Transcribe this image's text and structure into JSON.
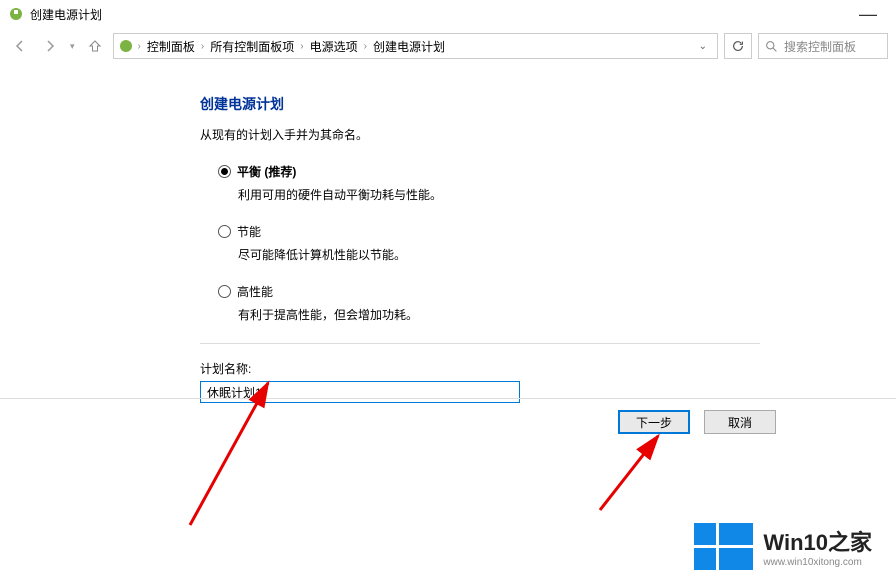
{
  "titlebar": {
    "title": "创建电源计划"
  },
  "breadcrumb": {
    "items": [
      "控制面板",
      "所有控制面板项",
      "电源选项",
      "创建电源计划"
    ]
  },
  "search": {
    "placeholder": "搜索控制面板"
  },
  "page": {
    "title": "创建电源计划",
    "subtitle": "从现有的计划入手并为其命名。"
  },
  "options": {
    "balanced": {
      "label": "平衡 (推荐)",
      "desc": "利用可用的硬件自动平衡功耗与性能。"
    },
    "saver": {
      "label": "节能",
      "desc": "尽可能降低计算机性能以节能。"
    },
    "performance": {
      "label": "高性能",
      "desc": "有利于提高性能，但会增加功耗。"
    }
  },
  "plan": {
    "label": "计划名称:",
    "value": "休眠计划1"
  },
  "buttons": {
    "next": "下一步",
    "cancel": "取消"
  },
  "logo": {
    "main": "Win10之家",
    "sub": "www.win10xitong.com"
  }
}
